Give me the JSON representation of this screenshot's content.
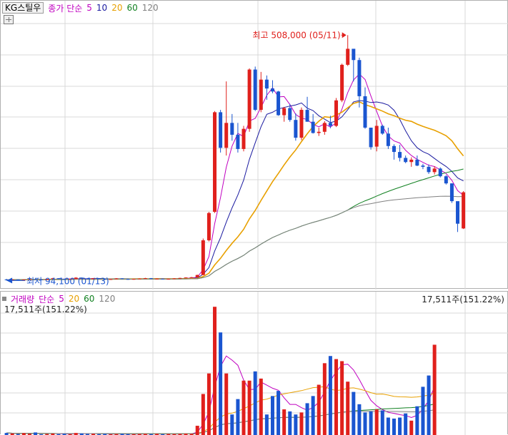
{
  "price_legend": {
    "stock_name": "KG스틸우",
    "ma_label": "종가 단순",
    "periods": [
      "5",
      "10",
      "20",
      "60",
      "120"
    ],
    "period_colors": [
      "#c000c0",
      "#1a1aa0",
      "#e8a000",
      "#108020",
      "#808080"
    ]
  },
  "volume_legend": {
    "title": "거래량",
    "ma_label": "단순",
    "periods": [
      "5",
      "20",
      "60",
      "120"
    ],
    "period_colors": [
      "#c000c0",
      "#e8a000",
      "#108020",
      "#808080"
    ],
    "current_value": "17,511주(151.22%)"
  },
  "annotations": {
    "high_label": "최고 508,000 (05/11)",
    "low_label": "최저 94,100 (01/13)"
  },
  "colors": {
    "up": "#e0201c",
    "down": "#1a55d0",
    "grid": "#d9d9d9"
  },
  "chart_data": [
    {
      "type": "candlestick",
      "title": "KG스틸우",
      "candles": [
        [
          96000,
          97000,
          94100,
          95000
        ],
        [
          95000,
          96500,
          94500,
          96000
        ],
        [
          96000,
          96000,
          94800,
          95200
        ],
        [
          95200,
          96200,
          94900,
          95800
        ],
        [
          95800,
          96800,
          95300,
          96400
        ],
        [
          96400,
          97600,
          95900,
          96000
        ],
        [
          96000,
          96300,
          94900,
          95200
        ],
        [
          95200,
          97000,
          95000,
          96800
        ],
        [
          96800,
          98600,
          96500,
          98000
        ],
        [
          98000,
          98200,
          96200,
          96600
        ],
        [
          96600,
          97400,
          95800,
          96200
        ],
        [
          96200,
          97200,
          95700,
          96900
        ],
        [
          96900,
          99800,
          96600,
          99000
        ],
        [
          99000,
          99400,
          97200,
          97600
        ],
        [
          97600,
          97900,
          96100,
          96500
        ],
        [
          96500,
          98400,
          96200,
          98000
        ],
        [
          98000,
          98100,
          96600,
          96900
        ],
        [
          96900,
          97700,
          95600,
          96000
        ],
        [
          96000,
          96900,
          95400,
          96500
        ],
        [
          96500,
          98200,
          96200,
          97800
        ],
        [
          97800,
          98100,
          96300,
          96700
        ],
        [
          96700,
          97400,
          95600,
          95900
        ],
        [
          95900,
          97100,
          95600,
          96800
        ],
        [
          96800,
          97900,
          96500,
          97500
        ],
        [
          97500,
          98700,
          97200,
          98100
        ],
        [
          98100,
          98400,
          96600,
          96900
        ],
        [
          96900,
          97700,
          96300,
          97300
        ],
        [
          97300,
          97600,
          96200,
          96400
        ],
        [
          96400,
          97300,
          96100,
          96900
        ],
        [
          96900,
          98200,
          96600,
          97800
        ],
        [
          97800,
          98900,
          97400,
          98500
        ],
        [
          98500,
          99600,
          98100,
          99300
        ],
        [
          99300,
          100200,
          98600,
          99700
        ],
        [
          99700,
          104000,
          99500,
          103500
        ],
        [
          103500,
          165000,
          103000,
          162000
        ],
        [
          162000,
          210000,
          160000,
          208000
        ],
        [
          210000,
          380000,
          208000,
          378000
        ],
        [
          378000,
          382000,
          310000,
          318000
        ],
        [
          318000,
          430000,
          305000,
          360000
        ],
        [
          360000,
          375000,
          330000,
          340000
        ],
        [
          340000,
          360000,
          310000,
          316000
        ],
        [
          316000,
          355000,
          312000,
          350000
        ],
        [
          350000,
          452000,
          345000,
          450000
        ],
        [
          450000,
          455000,
          380000,
          382000
        ],
        [
          382000,
          446000,
          378000,
          433000
        ],
        [
          433000,
          440000,
          399000,
          418000
        ],
        [
          418000,
          432000,
          410000,
          413000
        ],
        [
          413000,
          414000,
          372000,
          373000
        ],
        [
          373000,
          387000,
          362000,
          385000
        ],
        [
          385000,
          392000,
          362000,
          365000
        ],
        [
          365000,
          376000,
          330000,
          335000
        ],
        [
          335000,
          386000,
          331000,
          382000
        ],
        [
          382000,
          404000,
          362000,
          362000
        ],
        [
          362000,
          375000,
          342000,
          343000
        ],
        [
          343000,
          352000,
          338000,
          345000
        ],
        [
          345000,
          363000,
          340000,
          360000
        ],
        [
          360000,
          372000,
          351000,
          355000
        ],
        [
          355000,
          402000,
          353000,
          398000
        ],
        [
          398000,
          460000,
          395000,
          458000
        ],
        [
          458000,
          508000,
          456000,
          485000
        ],
        [
          485000,
          480000,
          430000,
          466000
        ],
        [
          466000,
          470000,
          386000,
          405000
        ],
        [
          405000,
          420000,
          350000,
          352000
        ],
        [
          352000,
          350000,
          315000,
          319000
        ],
        [
          320000,
          365000,
          312000,
          355000
        ],
        [
          355000,
          357000,
          340000,
          342000
        ],
        [
          342000,
          352000,
          316000,
          321000
        ],
        [
          321000,
          324000,
          298000,
          311000
        ],
        [
          311000,
          323000,
          295000,
          301000
        ],
        [
          301000,
          305000,
          292000,
          294000
        ],
        [
          294000,
          302000,
          286000,
          298000
        ],
        [
          298000,
          305000,
          287000,
          288000
        ],
        [
          288000,
          291000,
          282000,
          286000
        ],
        [
          286000,
          290000,
          274000,
          277000
        ],
        [
          277000,
          287000,
          273000,
          283000
        ],
        [
          283000,
          285000,
          268000,
          270000
        ],
        [
          270000,
          272000,
          256000,
          258000
        ],
        [
          258000,
          258000,
          225000,
          228000
        ],
        [
          228000,
          223000,
          176000,
          190000
        ],
        [
          182000,
          245000,
          181000,
          243000
        ]
      ],
      "ma_lines": [
        "5",
        "10",
        "20",
        "60",
        "120"
      ],
      "ylim": [
        85000,
        530000
      ],
      "x_range": [
        -1,
        83
      ]
    },
    {
      "type": "bar",
      "title": "거래량",
      "values": [
        20,
        15,
        10,
        18,
        12,
        25,
        8,
        10,
        14,
        9,
        12,
        8,
        20,
        15,
        10,
        12,
        9,
        11,
        7,
        10,
        12,
        9,
        8,
        10,
        11,
        9,
        12,
        8,
        10,
        9,
        11,
        13,
        12,
        90,
        400,
        600,
        1250,
        1000,
        600,
        200,
        350,
        530,
        530,
        620,
        550,
        200,
        380,
        430,
        250,
        230,
        200,
        220,
        310,
        380,
        490,
        700,
        770,
        740,
        720,
        520,
        420,
        300,
        220,
        230,
        250,
        240,
        170,
        160,
        170,
        210,
        140,
        280,
        470,
        580,
        880
      ],
      "ma_lines": [
        "5",
        "20",
        "60",
        "120"
      ],
      "ylim": [
        0,
        1300
      ]
    }
  ]
}
